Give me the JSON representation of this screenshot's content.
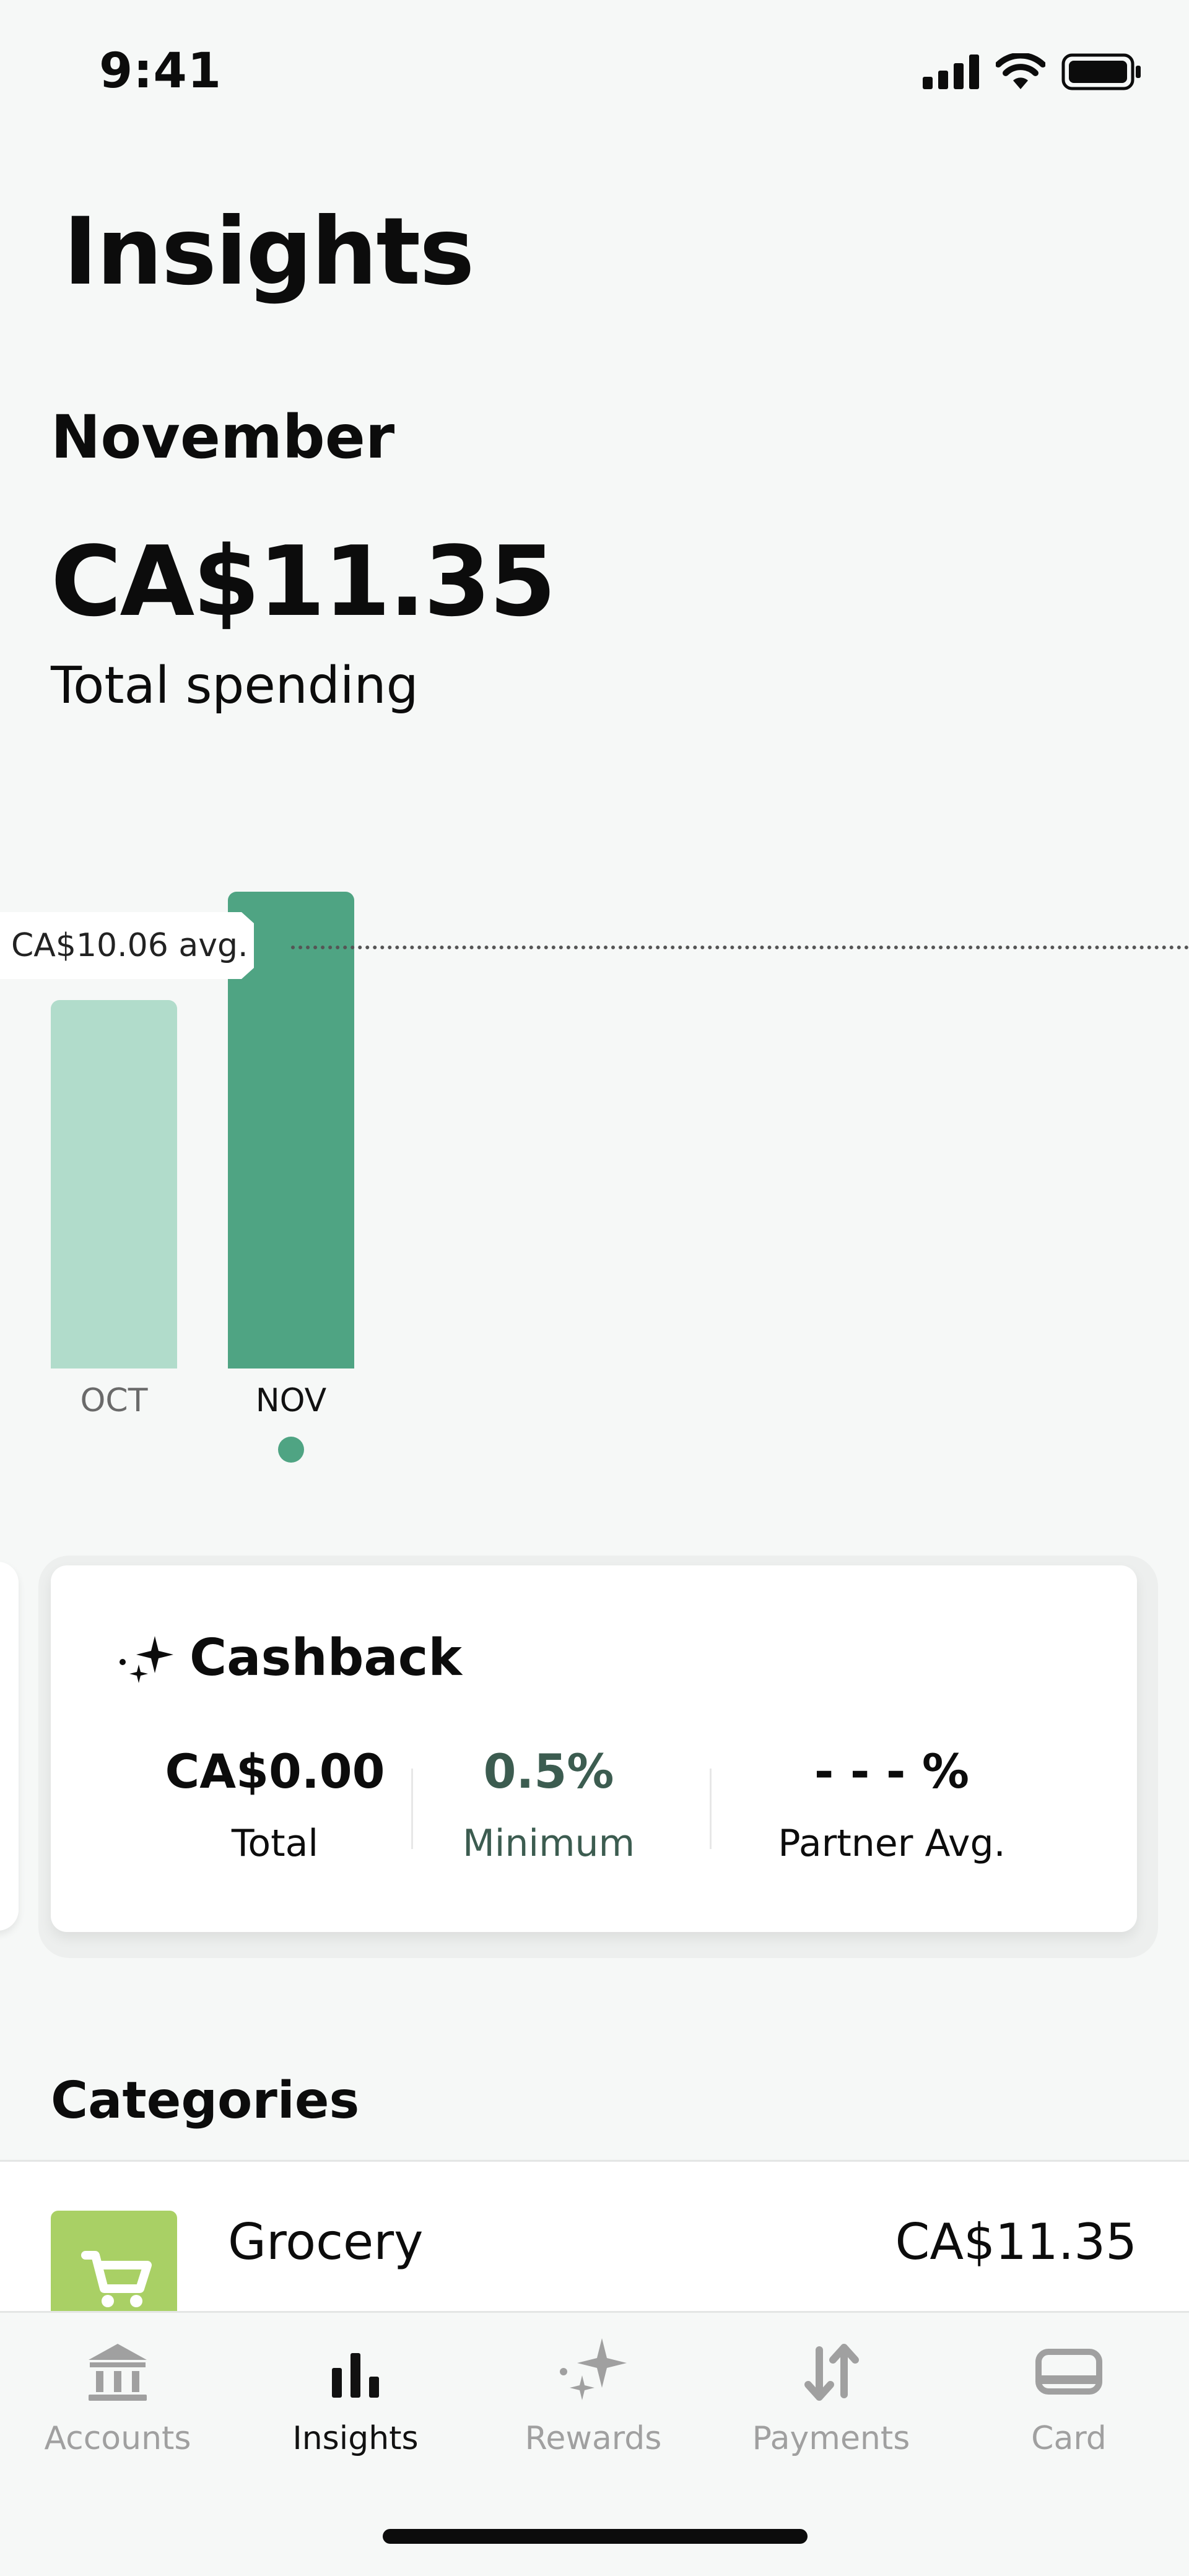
{
  "status_bar": {
    "time": "9:41"
  },
  "header": {
    "title": "Insights",
    "period": "November",
    "total_amount": "CA$11.35",
    "total_caption": "Total spending"
  },
  "chart_data": {
    "type": "bar",
    "categories": [
      "OCT",
      "NOV"
    ],
    "values": [
      8.77,
      11.35
    ],
    "average": 10.06,
    "average_label": "CA$10.06 avg.",
    "selected": "NOV",
    "ylim": [
      0,
      11.35
    ],
    "colors": {
      "past": "#B1DCCB",
      "selected": "#4FA483"
    }
  },
  "cashback": {
    "title": "Cashback",
    "stats": [
      {
        "value": "CA$0.00",
        "label": "Total"
      },
      {
        "value": "0.5%",
        "label": "Minimum"
      },
      {
        "value": "- - - %",
        "label": "Partner Avg."
      }
    ]
  },
  "categories": {
    "title": "Categories",
    "items": [
      {
        "name": "Grocery",
        "amount": "CA$11.35",
        "icon": "cart-icon"
      }
    ]
  },
  "tabbar": {
    "items": [
      {
        "label": "Accounts",
        "icon": "bank-icon",
        "active": false
      },
      {
        "label": "Insights",
        "icon": "bar-chart-icon",
        "active": true
      },
      {
        "label": "Rewards",
        "icon": "sparkle-icon",
        "active": false
      },
      {
        "label": "Payments",
        "icon": "transfer-arrows-icon",
        "active": false
      },
      {
        "label": "Card",
        "icon": "card-icon",
        "active": false
      }
    ]
  },
  "colors": {
    "accent": "#4FA483",
    "background": "#F6F8F7",
    "grocery": "#A9D065"
  }
}
